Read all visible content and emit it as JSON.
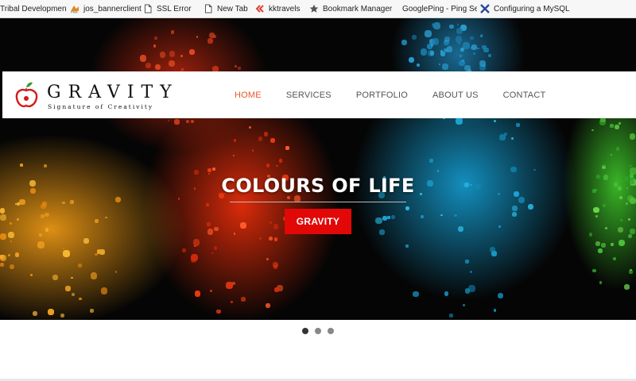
{
  "bookmarks": [
    {
      "label": "Tribal Development D",
      "icon": "folder-icon"
    },
    {
      "label": "jos_bannerclient",
      "icon": "pma-icon"
    },
    {
      "label": "SSL Error",
      "icon": "page-icon"
    },
    {
      "label": "New Tab",
      "icon": "page-icon"
    },
    {
      "label": "kktravels",
      "icon": "double-chevron-icon"
    },
    {
      "label": "Bookmark Manager",
      "icon": "star-icon"
    },
    {
      "label": "GooglePing - Ping Se",
      "icon": "none"
    },
    {
      "label": "Configuring a MySQL",
      "icon": "x-logo-icon"
    }
  ],
  "brand": {
    "name": "GRAVITY",
    "tagline": "Signature of Creativity"
  },
  "nav": [
    {
      "label": "HOME",
      "active": true
    },
    {
      "label": "SERVICES",
      "active": false
    },
    {
      "label": "PORTFOLIO",
      "active": false
    },
    {
      "label": "ABOUT US",
      "active": false
    },
    {
      "label": "CONTACT",
      "active": false
    }
  ],
  "slide": {
    "title": "COLOURS OF LIFE",
    "button_label": "GRAVITY"
  },
  "carousel": {
    "total_slides": 3,
    "active_index": 0
  },
  "colors": {
    "accent_nav": "#e8572d",
    "button_red": "#e20808",
    "hero_bg": "#050505"
  }
}
